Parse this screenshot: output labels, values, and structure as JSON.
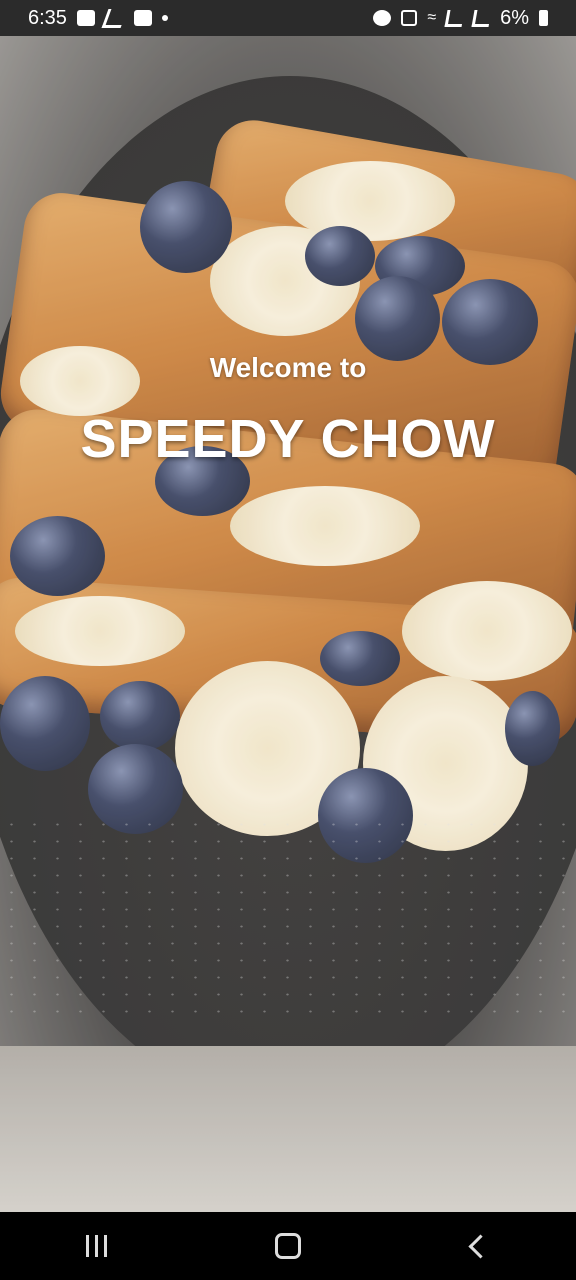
{
  "status_bar": {
    "time": "6:35",
    "battery": "6%",
    "icons_left": [
      "gallery-icon",
      "missed-call-icon",
      "message-icon",
      "notification-dot-icon"
    ],
    "icons_right": [
      "alarm-icon",
      "mute-icon",
      "wifi-icon",
      "signal-icon",
      "signal-icon",
      "battery-icon"
    ]
  },
  "splash": {
    "welcome_text": "Welcome to",
    "app_name": "SPEEDY CHOW"
  },
  "nav_bar": {
    "icons": [
      "recents-icon",
      "home-icon",
      "back-icon"
    ]
  }
}
